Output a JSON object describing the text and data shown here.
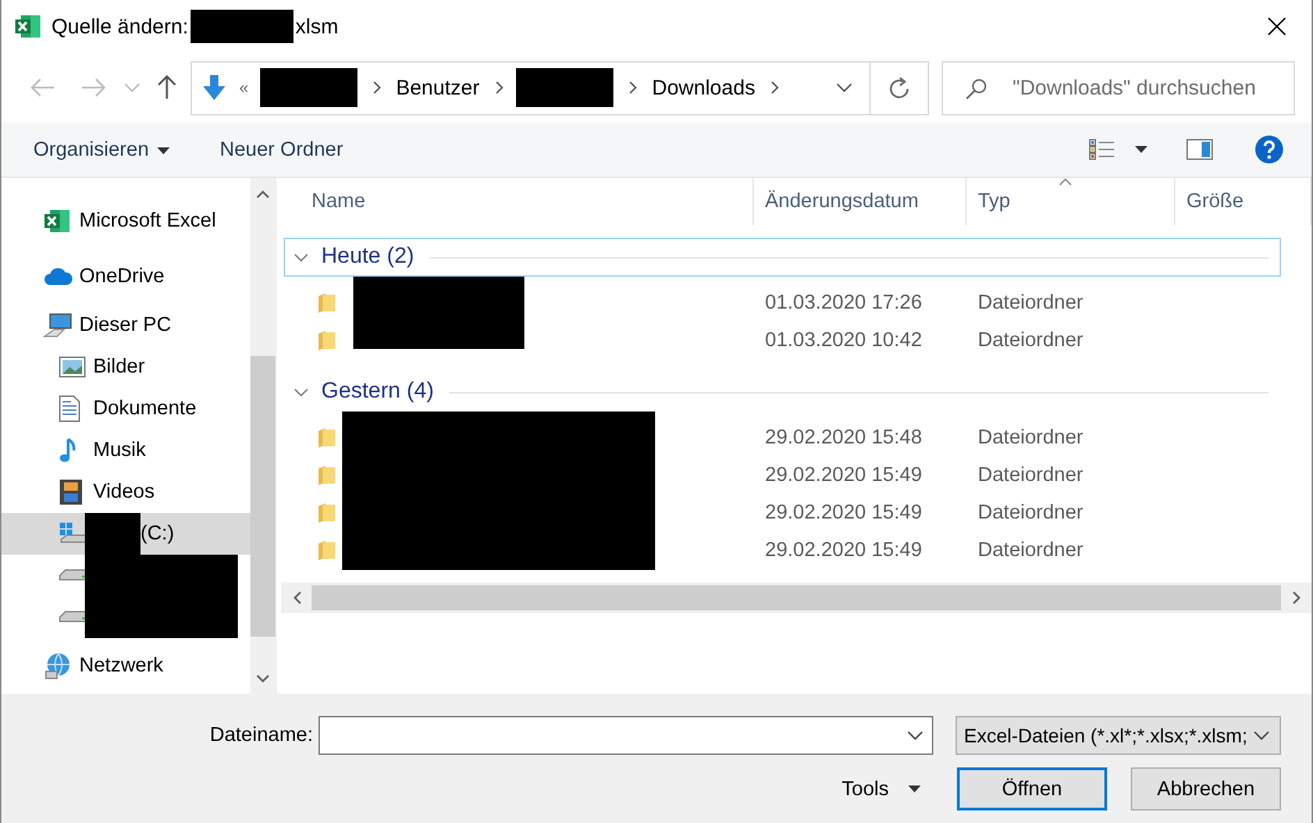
{
  "window": {
    "title_prefix": "Quelle ändern:",
    "title_redacted": true,
    "title_suffix": "xlsm"
  },
  "nav": {
    "overflow": "«",
    "breadcrumbs": [
      {
        "kind": "redacted"
      },
      {
        "kind": "text",
        "label": "Benutzer"
      },
      {
        "kind": "redacted"
      },
      {
        "kind": "text",
        "label": "Downloads"
      }
    ],
    "search": {
      "placeholder": "\"Downloads\" durchsuchen"
    }
  },
  "command_bar": [
    {
      "label": "Organisieren",
      "dropdown": true
    },
    {
      "label": "Neuer Ordner",
      "dropdown": false
    }
  ],
  "sidebar": {
    "items": [
      {
        "kind": "excel",
        "label": "Microsoft Excel",
        "selected": false
      },
      {
        "kind": "cloud",
        "label": "OneDrive",
        "selected": false
      },
      {
        "kind": "pc",
        "label": "Dieser PC",
        "selected": false
      },
      {
        "kind": "pictures",
        "label": "Bilder",
        "selected": false
      },
      {
        "kind": "documents",
        "label": "Dokumente",
        "selected": false
      },
      {
        "kind": "music",
        "label": "Musik",
        "selected": false
      },
      {
        "kind": "videos",
        "label": "Videos",
        "selected": false
      },
      {
        "kind": "system-drive",
        "label": "(C:)",
        "redacted": true,
        "selected": true
      },
      {
        "kind": "drive",
        "redacted": true,
        "selected": false
      },
      {
        "kind": "drive",
        "redacted": true,
        "selected": false
      },
      {
        "kind": "network",
        "label": "Netzwerk",
        "selected": false
      }
    ]
  },
  "table": {
    "columns": [
      {
        "label": "Name",
        "sorted": false
      },
      {
        "label": "Änderungsdatum",
        "sorted": false
      },
      {
        "label": "Typ",
        "sorted": true
      },
      {
        "label": "Größe",
        "sorted": false
      }
    ],
    "groups": [
      {
        "label": "Heute (2)",
        "expanded": true,
        "focused": true,
        "names_redacted": true,
        "rows": [
          {
            "date": "01.03.2020 17:26",
            "type": "Dateiordner"
          },
          {
            "date": "01.03.2020 10:42",
            "type": "Dateiordner"
          }
        ]
      },
      {
        "label": "Gestern (4)",
        "expanded": true,
        "focused": false,
        "names_redacted": true,
        "rows": [
          {
            "date": "29.02.2020 15:48",
            "type": "Dateiordner"
          },
          {
            "date": "29.02.2020 15:49",
            "type": "Dateiordner"
          },
          {
            "date": "29.02.2020 15:49",
            "type": "Dateiordner"
          },
          {
            "date": "29.02.2020 15:49",
            "type": "Dateiordner"
          }
        ]
      }
    ]
  },
  "footer": {
    "filename_label": "Dateiname:",
    "filter": "Excel-Dateien (*.xl*;*.xlsx;*.xlsm;",
    "tools": "Tools",
    "buttons": [
      {
        "label": "Öffnen",
        "default": true
      },
      {
        "label": "Abbrechen",
        "default": false
      }
    ]
  }
}
